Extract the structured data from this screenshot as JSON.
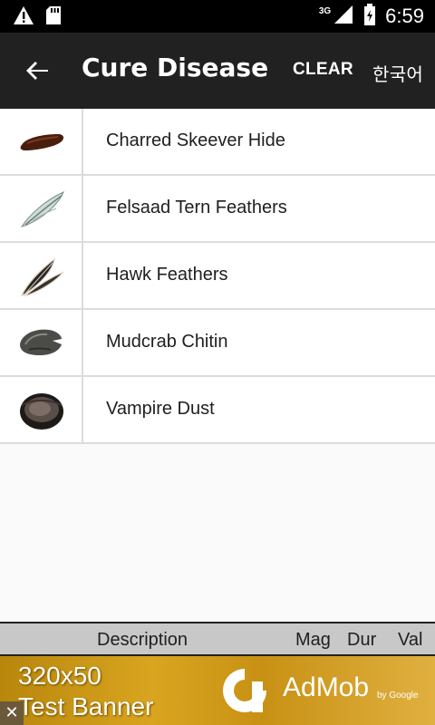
{
  "status_bar": {
    "time": "6:59",
    "network": "3G",
    "icons": [
      "warning-icon",
      "sd-card-icon",
      "signal-icon",
      "battery-icon"
    ]
  },
  "toolbar": {
    "title": "Cure Disease",
    "clear_label": "CLEAR",
    "language_label": "한국어"
  },
  "ingredients": [
    {
      "label": "Charred Skeever Hide",
      "icon": "skeever-hide-icon"
    },
    {
      "label": "Felsaad Tern Feathers",
      "icon": "tern-feathers-icon"
    },
    {
      "label": "Hawk Feathers",
      "icon": "hawk-feathers-icon"
    },
    {
      "label": "Mudcrab Chitin",
      "icon": "mudcrab-chitin-icon"
    },
    {
      "label": "Vampire Dust",
      "icon": "vampire-dust-icon"
    }
  ],
  "detail_header": {
    "description": "Description",
    "mag": "Mag",
    "dur": "Dur",
    "val": "Val"
  },
  "ad": {
    "line1": "320x50",
    "line2": "Test Banner",
    "brand": "AdMob",
    "by_google": "by Google",
    "close": "✕"
  }
}
